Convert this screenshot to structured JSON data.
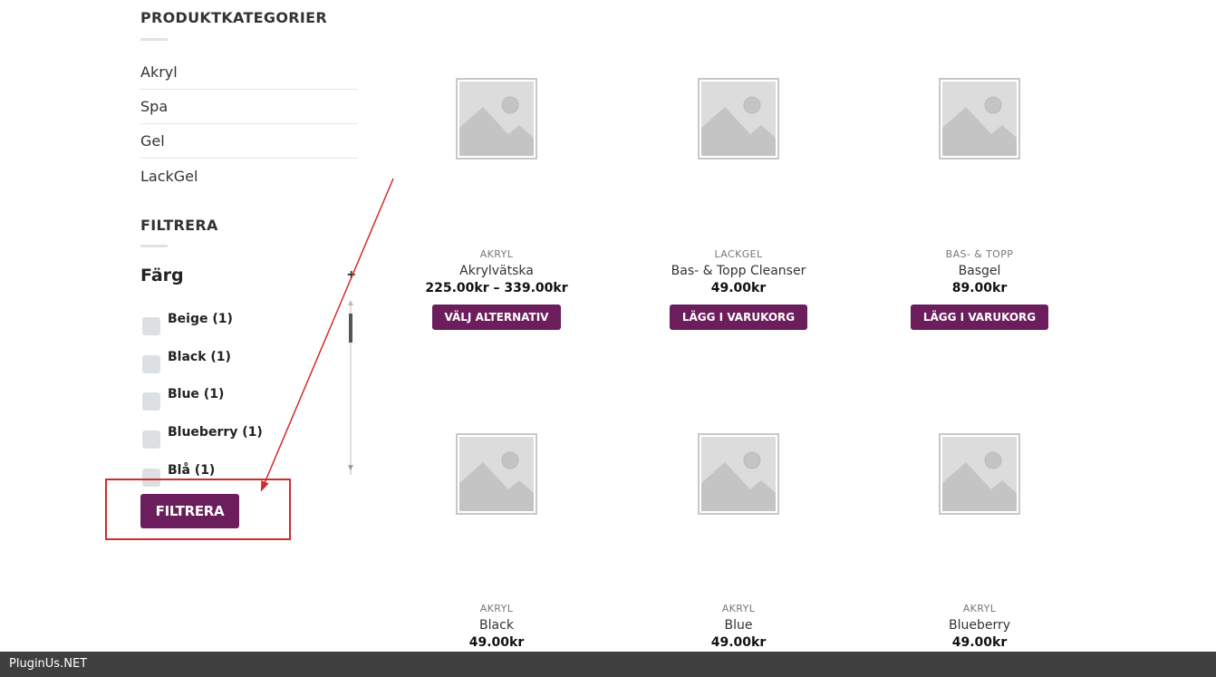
{
  "sidebar": {
    "categories_title": "PRODUKTKATEGORIER",
    "categories": [
      "Akryl",
      "Spa",
      "Gel",
      "LackGel"
    ],
    "filter_title": "FILTRERA",
    "color_title": "Färg",
    "colors": [
      "Beige (1)",
      "Black (1)",
      "Blue (1)",
      "Blueberry (1)",
      "Blå (1)"
    ],
    "filter_button": "FILTRERA"
  },
  "products": [
    {
      "category": "AKRYL",
      "name": "Akrylvätska",
      "price": "225.00kr – 339.00kr",
      "button": "VÄLJ ALTERNATIV"
    },
    {
      "category": "LACKGEL",
      "name": "Bas- & Topp Cleanser",
      "price": "49.00kr",
      "button": "LÄGG I VARUKORG"
    },
    {
      "category": "BAS- & TOPP",
      "name": "Basgel",
      "price": "89.00kr",
      "button": "LÄGG I VARUKORG"
    },
    {
      "category": "AKRYL",
      "name": "Black",
      "price": "49.00kr",
      "button": ""
    },
    {
      "category": "AKRYL",
      "name": "Blue",
      "price": "49.00kr",
      "button": ""
    },
    {
      "category": "AKRYL",
      "name": "Blueberry",
      "price": "49.00kr",
      "button": ""
    }
  ],
  "footer": {
    "text": "PluginUs.NET"
  },
  "colors": {
    "accent": "#6c1e5c",
    "annotation": "#d42a2a",
    "footer_bg": "#3f3f3f"
  },
  "icons": {
    "product_image": "image-placeholder-icon",
    "expand": "plus-icon"
  }
}
